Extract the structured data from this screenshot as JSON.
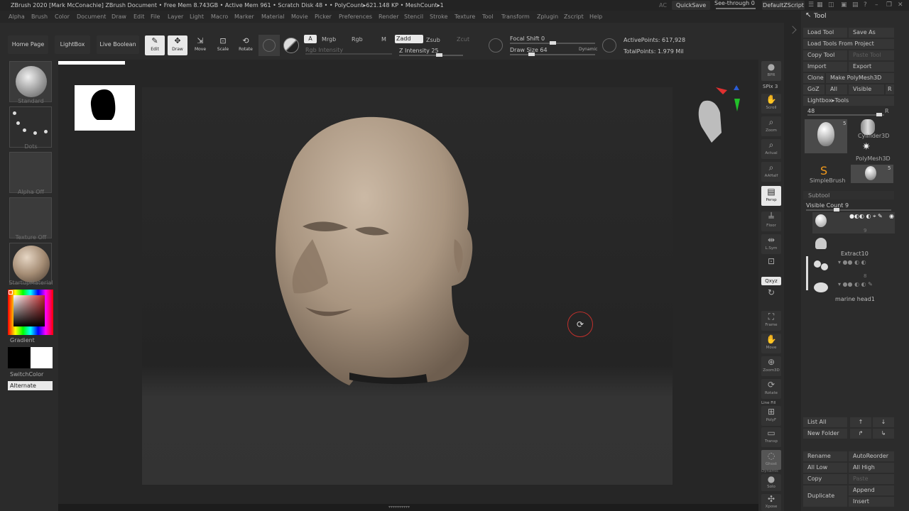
{
  "titlebar": {
    "text": "ZBrush 2020 [Mark McConachie]  ZBrush Document     • Free Mem 8.743GB • Active Mem 961 • Scratch Disk 48 • • PolyCount▸621.148 KP • MeshCount▸1",
    "ac": "AC",
    "quicksave": "QuickSave",
    "seethrough": "See-through  0",
    "script": "DefaultZScript"
  },
  "menu": [
    "Alpha",
    "Brush",
    "Color",
    "Document",
    "Draw",
    "Edit",
    "File",
    "Layer",
    "Light",
    "Macro",
    "Marker",
    "Material",
    "Movie",
    "Picker",
    "Preferences",
    "Render",
    "Stencil",
    "Stroke",
    "Texture",
    "Tool",
    "Transform",
    "Zplugin",
    "Zscript",
    "Help"
  ],
  "shelf": {
    "home": "Home Page",
    "lightbox": "LightBox",
    "liveboolean": "Live Boolean",
    "edit": "Edit",
    "draw": "Draw",
    "move": "Move",
    "scale": "Scale",
    "rotate": "Rotate",
    "a": "A",
    "mrgb": "Mrgb",
    "rgb": "Rgb",
    "m": "M",
    "zadd": "Zadd",
    "zsub": "Zsub",
    "zcut": "Zcut",
    "rgb_intensity": "Rgb Intensity",
    "z_intensity": "Z Intensity 25",
    "focal_shift": "Focal Shift 0",
    "draw_size": "Draw Size 64",
    "dynamic": "Dynamic",
    "active_points": "ActivePoints: 617,928",
    "total_points": "TotalPoints: 1.979 Mil"
  },
  "left": {
    "brush": "Standard",
    "stroke": "Dots",
    "alpha": "Alpha Off",
    "texture": "Texture Off",
    "material": "StartupMaterial",
    "gradient": "Gradient",
    "switchcolor": "SwitchColor",
    "alternate": "Alternate"
  },
  "right": {
    "bpr": "BPR",
    "spix": "SPix 3",
    "scroll": "Scroll",
    "zoom": "Zoom",
    "actual": "Actual",
    "aahalf": "AAHalf",
    "persp": "Persp",
    "floor": "Floor",
    "lsym": "L.Sym",
    "xyz": "Qxyz",
    "frame": "Frame",
    "move": "Move",
    "zoom3d": "Zoom3D",
    "rotate": "Rotate",
    "linefill": "Line Fill",
    "polyf": "PolyF",
    "transp": "Transp",
    "ghost": "Ghost",
    "dynamic": "Dynamic",
    "solo": "Solo",
    "xpose": "Xpose"
  },
  "tool": {
    "title": "Tool",
    "load_tool": "Load Tool",
    "save_as": "Save As",
    "load_tools_project": "Load Tools From Project",
    "copy_tool": "Copy Tool",
    "paste_tool": "Paste Tool",
    "import": "Import",
    "export": "Export",
    "clone": "Clone",
    "make_polymesh": "Make PolyMesh3D",
    "goz": "GoZ",
    "all": "All",
    "visible": "Visible",
    "r": "R",
    "lightbox_tools": "Lightbox▸Tools",
    "slider_value": "48",
    "thumb_count_1": "5",
    "cylinder": "Cylinder3D",
    "polymesh": "PolyMesh3D",
    "simplebrush": "SimpleBrush",
    "thumb_count_2": "5",
    "thumb_num": "9"
  },
  "subtool": {
    "header": "Subtool",
    "visible_count": "Visible Count 9",
    "row1_num": "9",
    "extract": "Extract10",
    "row3_num": "8",
    "marine": "marine head1",
    "list_all": "List All",
    "new_folder": "New Folder",
    "rename": "Rename",
    "autoreorder": "AutoReorder",
    "all_low": "All Low",
    "all_high": "All High",
    "copy": "Copy",
    "paste": "Paste",
    "duplicate": "Duplicate",
    "append": "Append",
    "insert": "Insert"
  }
}
